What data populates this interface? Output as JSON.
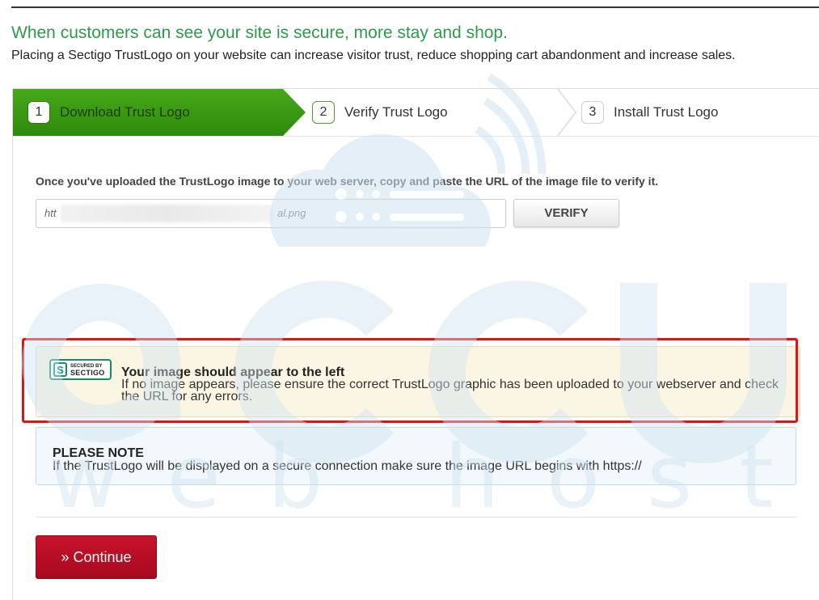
{
  "header": {
    "headline": "When customers can see your site is secure, more stay and shop.",
    "subline": "Placing a Sectigo TrustLogo on your website can increase visitor trust, reduce shopping cart abandonment and increase sales."
  },
  "steps": [
    {
      "number": "1",
      "label": "Download Trust Logo",
      "state": "active"
    },
    {
      "number": "2",
      "label": "Verify Trust Logo",
      "state": "current"
    },
    {
      "number": "3",
      "label": "Install Trust Logo",
      "state": "pending"
    }
  ],
  "form": {
    "instruction": "Once you've uploaded the TrustLogo image to your web server, copy and paste the URL of the image file to verify it.",
    "url_prefix": "htt",
    "url_suffix": "al.png",
    "verify_label": "VERIFY"
  },
  "preview": {
    "seal_top": "SECURED BY",
    "seal_brand": "SECTIGO",
    "title": "Your image should appear to the left",
    "body": "If no image appears, please ensure the correct TrustLogo graphic has been uploaded to your webserver and check the URL for any errors."
  },
  "note": {
    "title": "PLEASE NOTE",
    "body": "If the TrustLogo will be displayed on a secure connection make sure the image URL begins with https://"
  },
  "actions": {
    "continue_label": "» Continue"
  },
  "watermark": {
    "brand": "accu",
    "tagline": "web hosting"
  },
  "colors": {
    "headline_green": "#2e9a4b",
    "step_active": "#3d9a14",
    "continue_red": "#b50e24",
    "highlight_red": "#e11414"
  }
}
